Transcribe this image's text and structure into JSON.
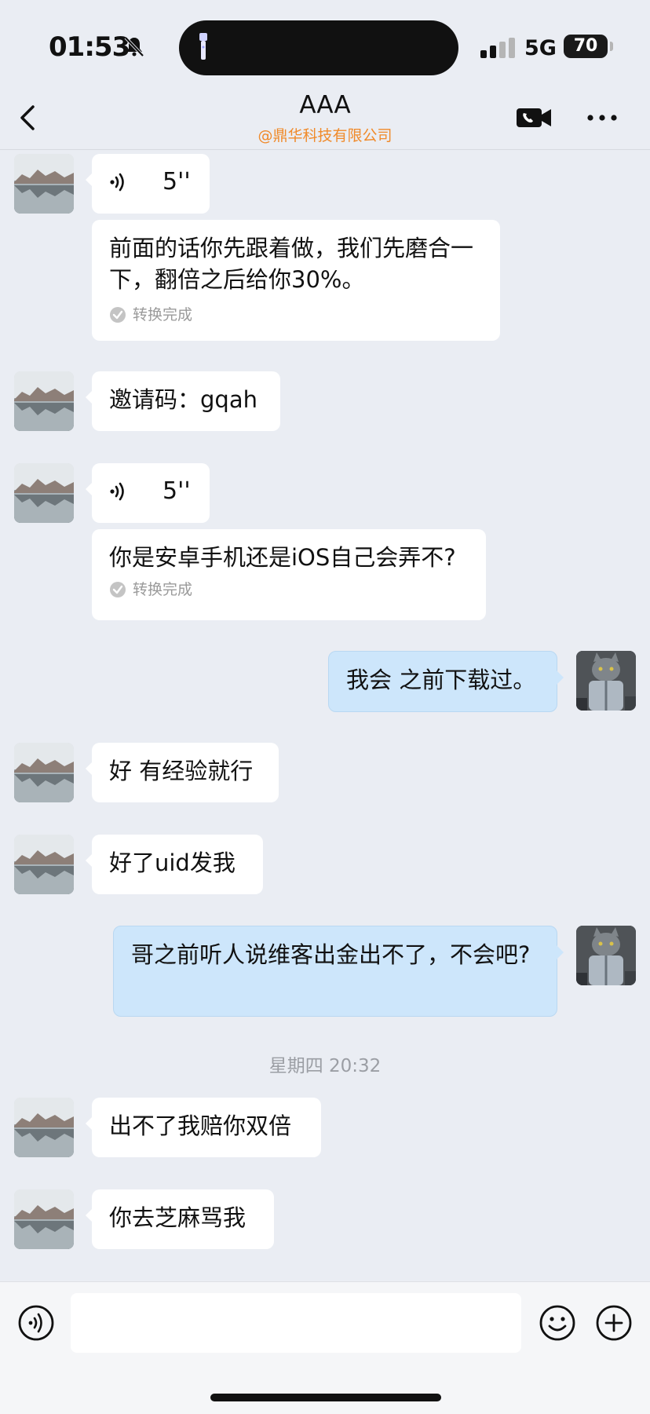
{
  "status_bar": {
    "time": "01:53",
    "network": "5G",
    "battery": "70"
  },
  "header": {
    "title": "AAA",
    "subtitle": "@鼎华科技有限公司"
  },
  "messages": [
    {
      "type": "voice",
      "duration": "5''",
      "transcript": "前面的话你先跟着做，我们先磨合一下，翻倍之后给你30%。",
      "transcript_status": "转换完成"
    },
    {
      "type": "text",
      "text": "邀请码：gqah"
    },
    {
      "type": "voice",
      "duration": "5''",
      "transcript": "你是安卓手机还是iOS自己会弄不?",
      "transcript_status": "转换完成"
    },
    {
      "type": "text_mine",
      "text": "我会 之前下载过。"
    },
    {
      "type": "text",
      "text": "好 有经验就行"
    },
    {
      "type": "text",
      "text": "好了uid发我"
    },
    {
      "type": "text_mine",
      "text": "哥之前听人说维客出金出不了，不会吧?"
    },
    {
      "type": "text",
      "text": "出不了我赔你双倍"
    },
    {
      "type": "text",
      "text": "你去芝麻骂我"
    }
  ],
  "timestamp": "星期四 20:32",
  "input": {
    "value": "",
    "placeholder": ""
  },
  "icons": {
    "back": "chevron-left-icon",
    "video_call": "video-call-icon",
    "more": "more-dots-icon",
    "voice": "voice-icon",
    "emoji": "emoji-icon",
    "add": "plus-icon"
  },
  "colors": {
    "background": "#eaedf3",
    "own_bubble": "#cde6fb",
    "other_bubble": "#ffffff",
    "subtitle": "#f08a2a"
  }
}
